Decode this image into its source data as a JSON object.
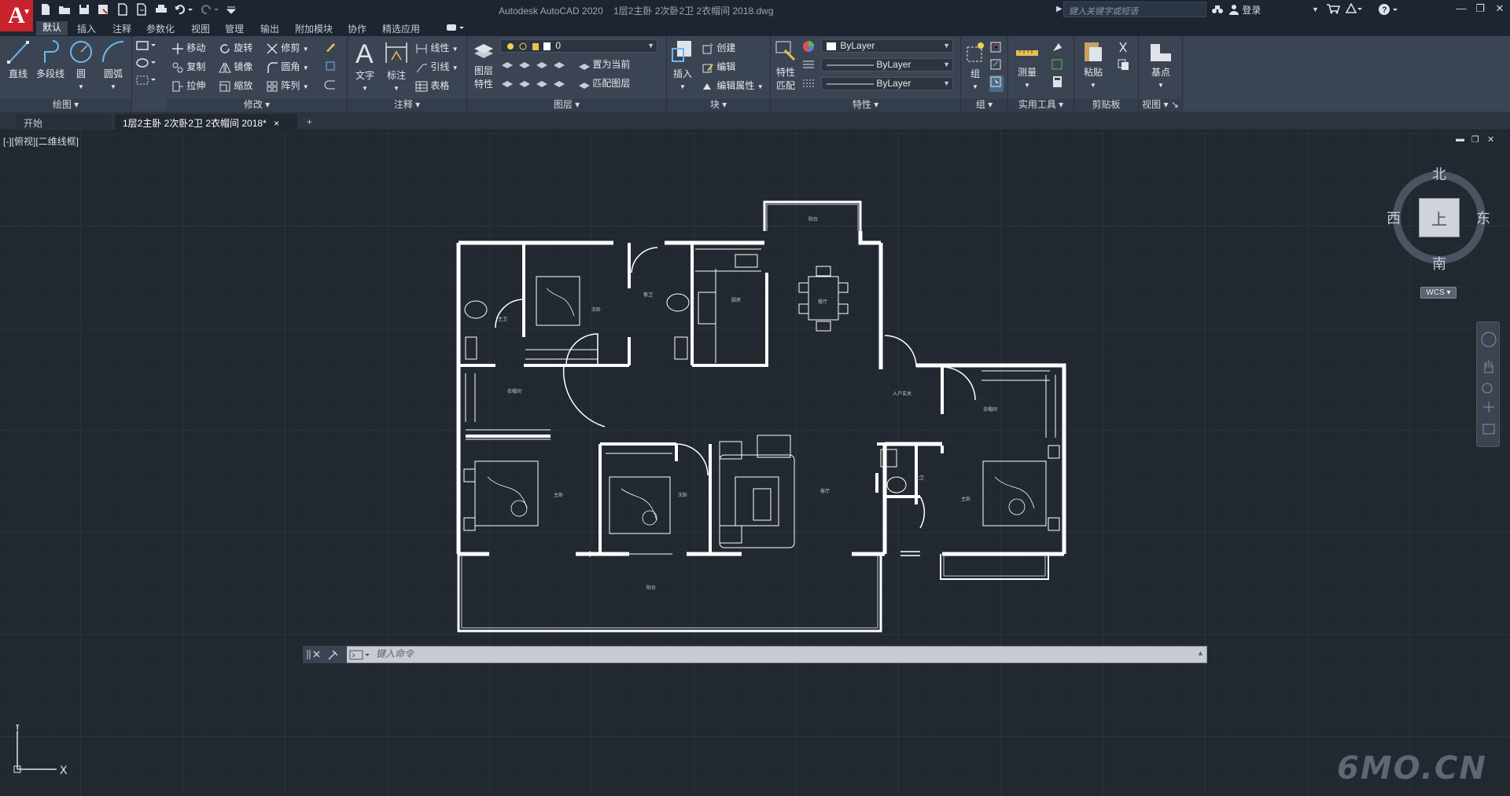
{
  "title_bar": {
    "app_logo": "A",
    "app_title": "Autodesk AutoCAD 2020",
    "file_name": "1层2主卧 2次卧2卫 2衣帽间  2018.dwg",
    "search_placeholder": "键入关键字或短语",
    "login_label": "登录"
  },
  "menu_tabs": [
    "默认",
    "插入",
    "注释",
    "参数化",
    "视图",
    "管理",
    "输出",
    "附加模块",
    "协作",
    "精选应用"
  ],
  "ribbon": {
    "draw": {
      "title": "绘图",
      "line": "直线",
      "polyline": "多段线",
      "circle": "圆",
      "arc": "圆弧"
    },
    "modify": {
      "title": "修改",
      "move": "移动",
      "rotate": "旋转",
      "trim": "修剪",
      "copy": "复制",
      "mirror": "镜像",
      "fillet": "圆角",
      "stretch": "拉伸",
      "scale": "缩放",
      "array": "阵列"
    },
    "annotation": {
      "title": "注释",
      "text": "文字",
      "dimension": "标注",
      "linear": "线性",
      "leader": "引线",
      "table": "表格"
    },
    "layers": {
      "title": "图层",
      "layer_props": "图层\n特性",
      "layer_props_1": "图层",
      "layer_props_2": "特性",
      "current_layer": "0",
      "make_current": "置为当前",
      "match_layer": "匹配图层"
    },
    "block": {
      "title": "块",
      "insert": "插入",
      "create": "创建",
      "edit": "编辑",
      "edit_attr": "编辑属性"
    },
    "properties": {
      "title": "特性",
      "match_1": "特性",
      "match_2": "匹配",
      "color": "ByLayer",
      "linetype": "ByLayer",
      "lineweight": "ByLayer"
    },
    "groups": {
      "title": "组",
      "group": "组"
    },
    "utilities": {
      "title": "实用工具",
      "measure": "测量"
    },
    "clipboard": {
      "title": "剪贴板",
      "paste": "粘贴"
    },
    "view": {
      "title": "视图",
      "base": "基点"
    }
  },
  "doc_tabs": {
    "start": "开始",
    "current": "1层2主卧 2次卧2卫 2衣帽间  2018*",
    "close": "×",
    "add": "+"
  },
  "viewport": {
    "label": "[-][俯视][二维线框]"
  },
  "viewcube": {
    "north": "北",
    "south": "南",
    "east": "东",
    "west": "西",
    "top": "上",
    "wcs": "WCS"
  },
  "ucs": {
    "x": "X",
    "y": "Y"
  },
  "command": {
    "placeholder": "键入命令"
  },
  "plan_labels": {
    "balcony_top": "阳台",
    "master_bath": "主卫",
    "bedroom_top": "次卧",
    "bath2": "客卫",
    "kitchen": "厨房",
    "dining": "餐厅",
    "closet_left": "衣帽间",
    "entrance": "入户玄关",
    "closet_right": "衣帽间",
    "master_left": "主卧",
    "bedroom_mid": "次卧",
    "living": "客厅",
    "bath_right": "主卫",
    "master_right": "主卧",
    "balcony_bottom": "阳台"
  },
  "watermark": "6MO.CN"
}
